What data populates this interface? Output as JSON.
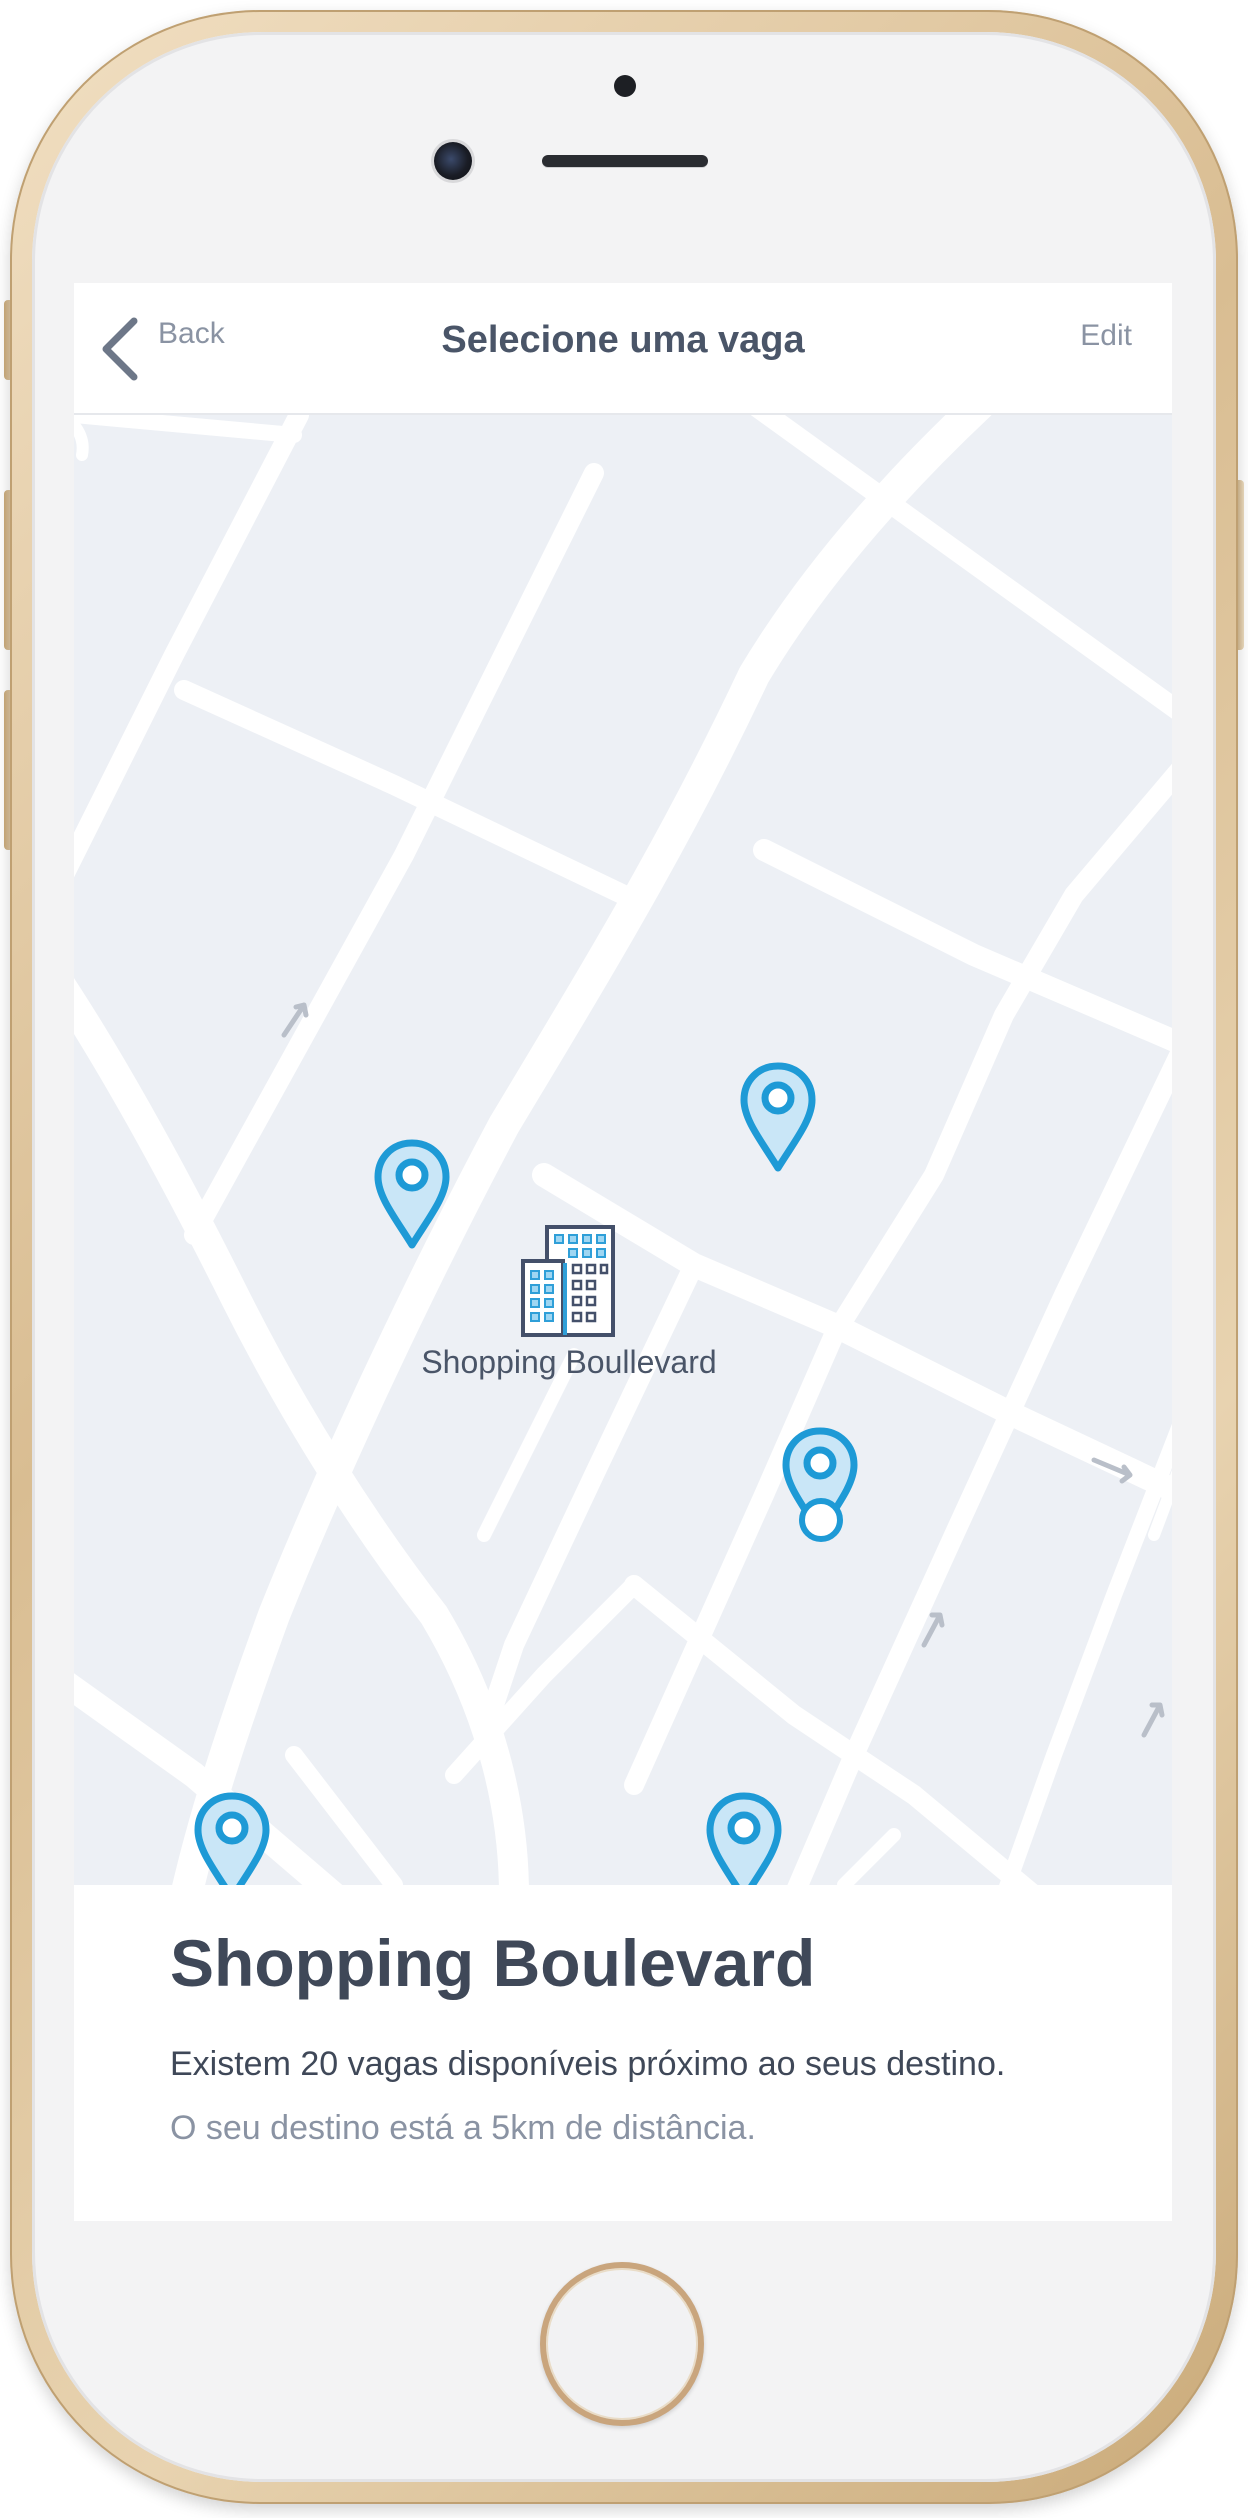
{
  "navbar": {
    "back_label": "Back",
    "title": "Selecione uma vaga",
    "edit_label": "Edit"
  },
  "map": {
    "landmark_label": "Shopping Boullevard",
    "pin_color": "#1e9ad6",
    "pin_fill": "#c9e6f7",
    "road_color": "#ffffff",
    "map_background": "#edf0f5"
  },
  "info": {
    "title": "Shopping Boulevard",
    "availability": "Existem 20 vagas disponíveis próximo ao seus destino.",
    "distance": "O seu destino está a 5km de distância."
  },
  "icons": {
    "back": "chevron-left-icon",
    "pin": "map-pin-icon",
    "landmark": "building-icon"
  }
}
